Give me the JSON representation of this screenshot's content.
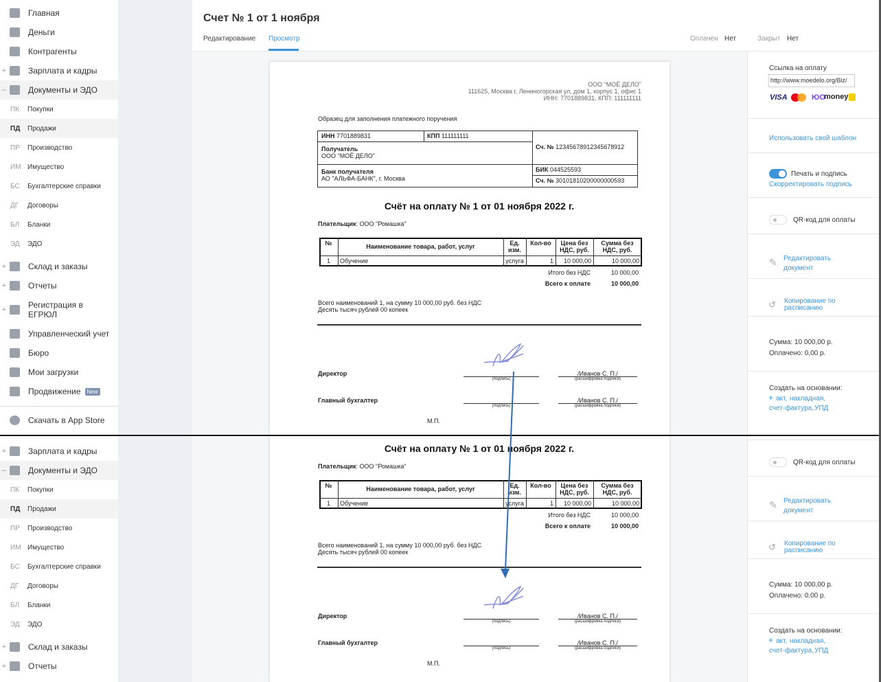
{
  "sidebar": {
    "items": [
      {
        "label": "Главная",
        "icon": "home-icon",
        "expander": ""
      },
      {
        "label": "Деньги",
        "icon": "money-icon",
        "expander": ""
      },
      {
        "label": "Контрагенты",
        "icon": "contractors-icon",
        "expander": ""
      },
      {
        "label": "Зарплата и кадры",
        "icon": "salary-icon",
        "expander": "+"
      },
      {
        "label": "Документы и ЭДО",
        "icon": "folder-icon",
        "expander": "–",
        "active": true
      },
      {
        "sub": true,
        "prefix": "ПК",
        "label": "Покупки"
      },
      {
        "sub": true,
        "prefix": "ПД",
        "label": "Продажи",
        "active": true
      },
      {
        "sub": true,
        "prefix": "ПР",
        "label": "Производство"
      },
      {
        "sub": true,
        "prefix": "ИМ",
        "label": "Имущество"
      },
      {
        "sub": true,
        "prefix": "БС",
        "label": "Бухгалтерские справки"
      },
      {
        "sub": true,
        "prefix": "ДГ",
        "label": "Договоры"
      },
      {
        "sub": true,
        "prefix": "БЛ",
        "label": "Бланки"
      },
      {
        "sub": true,
        "prefix": "ЭД",
        "label": "ЭДО"
      },
      {
        "label": "Склад и заказы",
        "icon": "warehouse-icon",
        "expander": "+"
      },
      {
        "label": "Отчеты",
        "icon": "reports-icon",
        "expander": "+"
      },
      {
        "label": "Регистрация в ЕГРЮЛ",
        "icon": "registration-icon",
        "expander": "+",
        "tall": true
      },
      {
        "label": "Управленческий учет",
        "icon": "management-icon",
        "expander": ""
      },
      {
        "label": "Бюро",
        "icon": "briefcase-icon",
        "expander": ""
      },
      {
        "label": "Мои загрузки",
        "icon": "download-icon",
        "expander": ""
      },
      {
        "label": "Продвижение",
        "icon": "promotion-icon",
        "expander": "",
        "badge": "New"
      }
    ],
    "app_store": "Скачать в App Store"
  },
  "header": {
    "title": "Счет № 1 от 1 ноября",
    "tabs": [
      "Редактирование",
      "Просмотр"
    ],
    "paid_label": "Оплачен",
    "paid_value": "Нет",
    "closed_label": "Закрыт",
    "closed_value": "Нет"
  },
  "doc": {
    "company": "ООО \"МОЁ ДЕЛО\"",
    "address": "111625, Москва г, Лениногорская ул, дом 1, корпус 1, офис 1",
    "inn_kpp": "ИНН: 7701889831, КПП: 111111111",
    "sample": "Образец для заполнения платежного поручения",
    "inn_label": "ИНН",
    "inn": "7701889831",
    "kpp_label": "КПП",
    "kpp": "111111111",
    "recipient_label": "Получатель",
    "recipient": "ООО \"МОЁ ДЕЛО\"",
    "account_label": "Сч. №",
    "account": "12345678912345678912",
    "bank_label": "Банк получателя",
    "bank": "АО \"АЛЬФА-БАНК\", г. Москва",
    "bik_label": "БИК",
    "bik": "044525593",
    "corr_label": "Сч. №",
    "corr": "30101810200000000593",
    "title": "Счёт на оплату № 1 от 01 ноября 2022 г.",
    "payer_label": "Плательщик",
    "payer": ": ООО \"Ромашка\"",
    "columns": [
      "№",
      "Наименование товара, работ, услуг",
      "Ед. изм.",
      "Кол-во",
      "Цена без НДС, руб.",
      "Сумма без НДС, руб."
    ],
    "rows": [
      [
        "1",
        "Обучение",
        "услуга",
        "1",
        "10 000,00",
        "10 000,00"
      ]
    ],
    "subtotal_label": "Итого без НДС",
    "subtotal": "10 000,00",
    "total_label": "Всего к оплате",
    "total": "10 000,00",
    "summary1": "Всего наименований 1, на сумму 10 000,00 руб. без НДС",
    "summary2": "Десять тысяч рублей 00 копеек",
    "director": "Директор",
    "accountant": "Главный бухгалтер",
    "sign_caption": "(подпись)",
    "decode_caption": "(расшифровка подписи)",
    "name": "/Иванов С. П./",
    "stamp": "М.П."
  },
  "panel": {
    "link_label": "Ссылка на оплату",
    "link_value": "http://www.moedelo.org/Biz/",
    "visa": "VISA",
    "money": "money",
    "template_link": "Использовать свой шаблон",
    "stamp_toggle": "Печать и подпись",
    "stamp_toggle_on": true,
    "adjust_sign": "Скорректировать подпись",
    "qr_toggle": "QR-код для оплаты",
    "qr_toggle_on": false,
    "edit_doc": [
      "Редактировать",
      "документ"
    ],
    "copy_schedule": [
      "Копирование по",
      "расписанию"
    ],
    "sum": "Сумма: 10 000,00 р.",
    "paid": "Оплачено: 0,00 р.",
    "create_label": "Создать на основании:",
    "create_links": [
      "акт,",
      "накладная,",
      "счет-фактура,",
      "УПД"
    ]
  },
  "colors": {
    "accent": "#3d94d9",
    "arrow": "#2f6db5"
  }
}
